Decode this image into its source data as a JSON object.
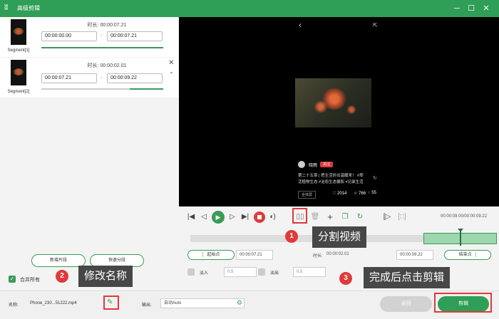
{
  "window": {
    "title": "高级剪辑",
    "minimize": "─",
    "maximize": "☐",
    "close": "✕"
  },
  "segments": [
    {
      "name": "Segment[1]",
      "duration_label": "时长:",
      "duration": "00:00:07.21",
      "start": "00:00:00.00",
      "end": "00:00:07.21"
    },
    {
      "name": "Segment[2]",
      "duration_label": "时长:",
      "duration": "00:00:02.01",
      "start": "00:00:07.21",
      "end": "00:00:09.22"
    }
  ],
  "left": {
    "add_segment": "新增片段",
    "quick_split": "快速分段",
    "merge_all": "合并所有"
  },
  "preview": {
    "back": "‹",
    "share": "⇱",
    "username": "晓雨",
    "tag": "关注",
    "caption_line1": "第二十五章 | 把生活折出温暖来！ #郑",
    "caption_line2": "活植物生态 #治愈生态摄影 #记录生活",
    "side_tag": "全体屏",
    "likes": "2014",
    "favs": "766",
    "comments": "55"
  },
  "controls": {
    "time_display": "00:00:09.00/00:00:09.22",
    "start_btn": "起始点",
    "start_time": "00:00:07.21",
    "duration_label": "时长:",
    "duration": "00:00:02.01",
    "end_time": "00:00:09.22",
    "end_btn": "结束点",
    "fade_in": "淡入",
    "fade_in_val": "0.5",
    "fade_out": "淡出",
    "fade_out_val": "0.5"
  },
  "bottom": {
    "name_label": "名称:",
    "filename": "Phone_230...51222.mp4",
    "output_label": "输出:",
    "output_value": "自动Auto",
    "back_btn": "返回",
    "cut_btn": "剪辑"
  },
  "callouts": [
    {
      "num": "1",
      "text": "分割视频"
    },
    {
      "num": "2",
      "text": "修改名称"
    },
    {
      "num": "3",
      "text": "完成后点击剪辑"
    }
  ],
  "colors": {
    "accent": "#2f9e56",
    "callout_red": "#e03a3a",
    "callout_bg": "#474747"
  }
}
